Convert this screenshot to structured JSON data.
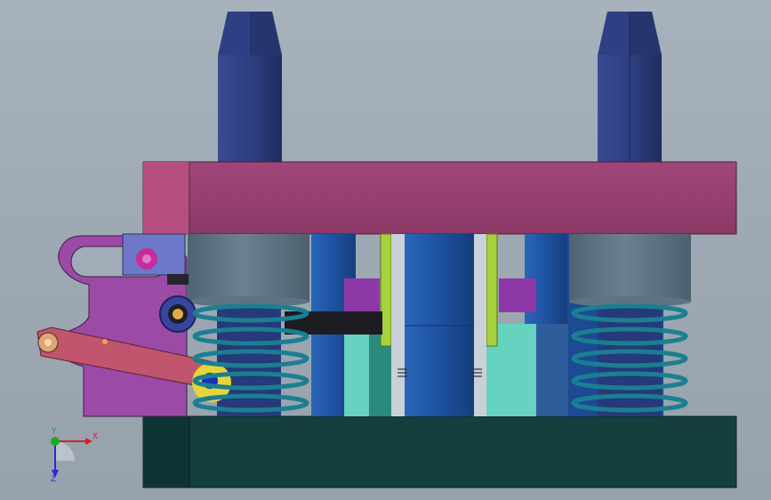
{
  "viewport": {
    "background": "#a1acb7"
  },
  "colors": {
    "upper_plate": "#973f6d",
    "lower_plate": "#153f3f",
    "guide_post": "#2d3f82",
    "spring": "#1b7f92",
    "punch_column": "#1f57a5",
    "bushing": "#5d7181",
    "lever_arm": "#c0556d",
    "linkage_plate": "#9b4aa6",
    "stripper_green": "#a7d13a",
    "turquoise_block": "#66d2c0",
    "purple_block": "#8e38a7"
  },
  "axis_triad": {
    "x_label": "X",
    "y_label": "Y",
    "z_label": "Z",
    "x_color": "#d62020",
    "y_color": "#1fa824",
    "z_color": "#2a2ad0"
  }
}
